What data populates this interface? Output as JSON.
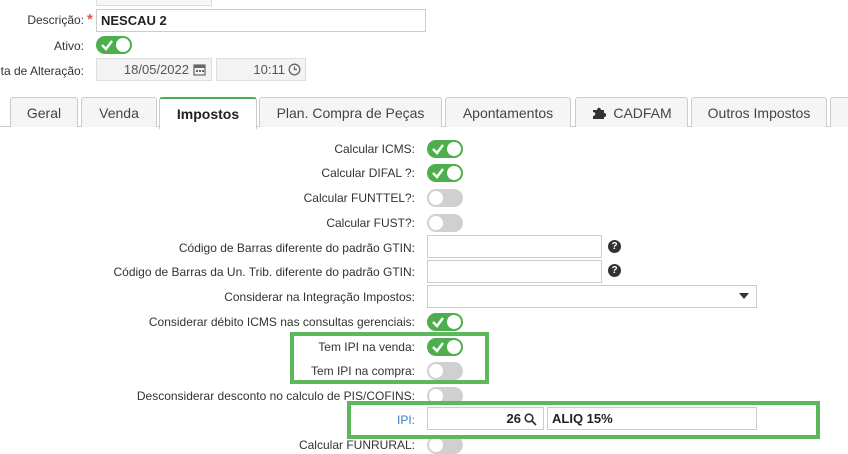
{
  "header": {
    "descricao_label": "Descrição:",
    "required_mark": "*",
    "descricao_value": "NESCAU 2",
    "ativo_label": "Ativo:",
    "data_alteracao_label": "ta de Alteração:",
    "date_value": "18/05/2022",
    "time_value": "10:11"
  },
  "tabs": [
    {
      "label": "Geral",
      "active": false
    },
    {
      "label": "Venda",
      "active": false
    },
    {
      "label": "Impostos",
      "active": true
    },
    {
      "label": "Plan. Compra de Peças",
      "active": false
    },
    {
      "label": "Apontamentos",
      "active": false
    },
    {
      "label": "CADFAM",
      "active": false,
      "icon": "puzzle-icon"
    },
    {
      "label": "Outros Impostos",
      "active": false
    }
  ],
  "fields": {
    "calc_icms": {
      "label": "Calcular ICMS:",
      "on": true
    },
    "calc_difal": {
      "label": "Calcular DIFAL ?:",
      "on": true
    },
    "calc_funttel": {
      "label": "Calcular FUNTTEL?:",
      "on": false
    },
    "calc_fust": {
      "label": "Calcular FUST?:",
      "on": false
    },
    "cod_barras_gtin": {
      "label": "Código de Barras diferente do padrão GTIN:",
      "value": ""
    },
    "cod_barras_trib": {
      "label": "Código de Barras da Un. Trib. diferente do padrão GTIN:",
      "value": ""
    },
    "considerar_integracao": {
      "label": "Considerar na Integração Impostos:",
      "value": ""
    },
    "considerar_debito": {
      "label": "Considerar débito ICMS nas consultas gerenciais:",
      "on": true
    },
    "ipi_venda": {
      "label": "Tem IPI na venda:",
      "on": true
    },
    "ipi_compra": {
      "label": "Tem IPI na compra:",
      "on": false
    },
    "desconsiderar_desconto": {
      "label": "Desconsiderar desconto no calculo de PIS/COFINS:",
      "on": false
    },
    "ipi": {
      "label": "IPI:",
      "code": "26",
      "description": "ALIQ 15%"
    },
    "calc_funrural": {
      "label": "Calcular FUNRURAL:",
      "on": false
    }
  },
  "colors": {
    "toggle_on": "#4cae4c",
    "toggle_off": "#d0d0d0",
    "highlight": "#5cb85c",
    "link_label": "#3a7bbf",
    "required": "#d9534f"
  }
}
